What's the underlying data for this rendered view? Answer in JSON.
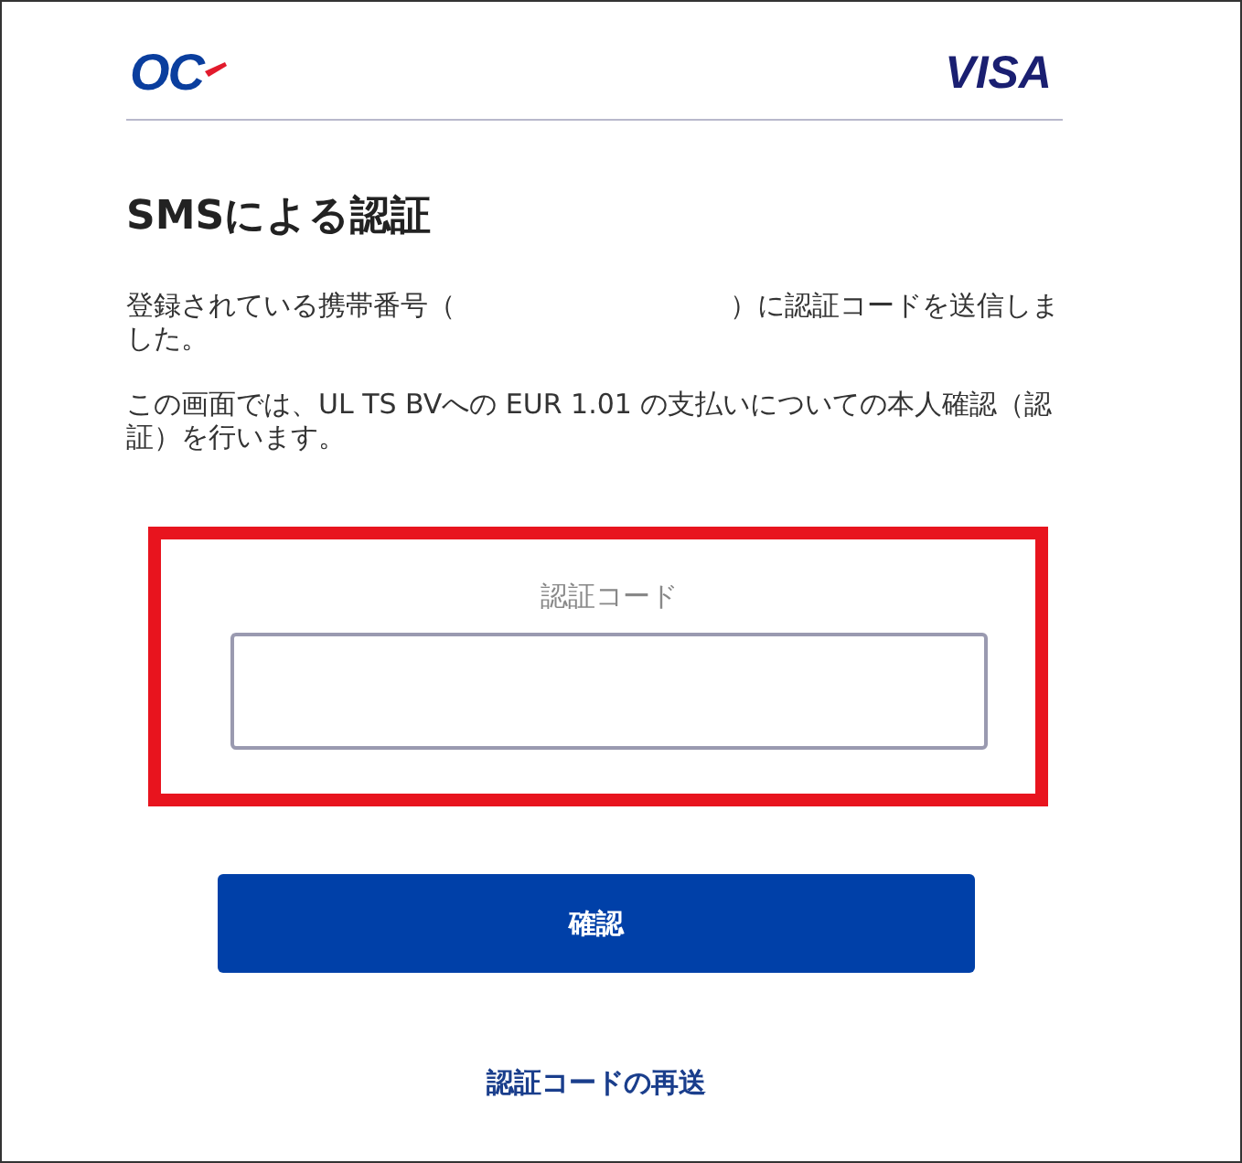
{
  "header": {
    "issuer_logo": "OC",
    "network_logo": "VISA"
  },
  "title": "SMSによる認証",
  "paragraphs": [
    "登録されている携帯番号（　　　　　　　　　　）に認証コードを送信しました。",
    "この画面では、UL TS BVへの EUR 1.01 の支払いについての本人確認（認証）を行います。"
  ],
  "code_field": {
    "label": "認証コード",
    "highlighted": true
  },
  "submit_button": "確認",
  "resend_link": "認証コードの再送"
}
